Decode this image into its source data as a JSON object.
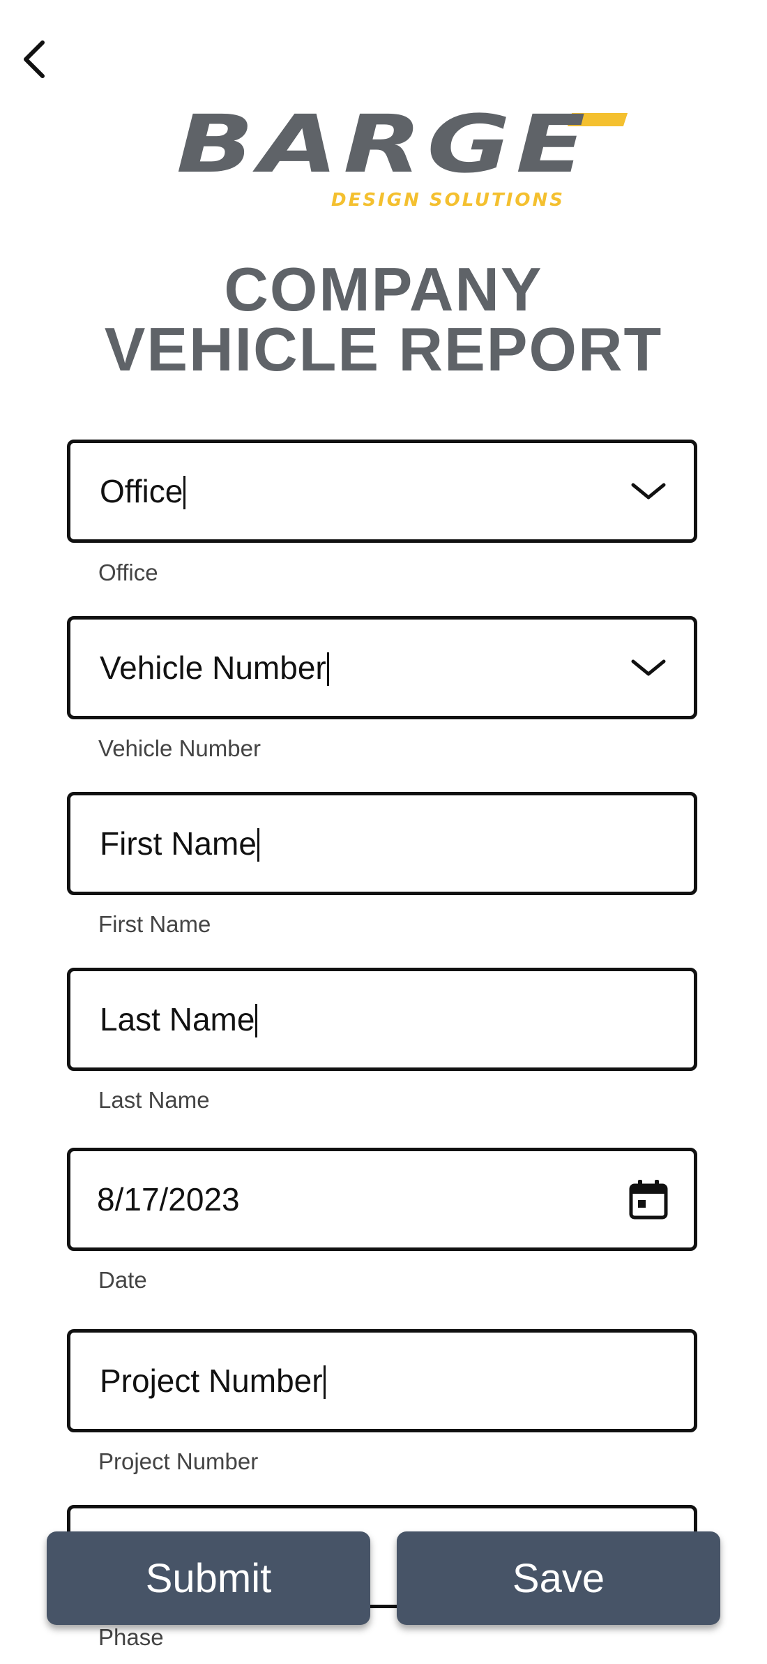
{
  "nav": {
    "back_icon": "chevron-left-icon"
  },
  "logo": {
    "word": "BARGE",
    "tagline": "DESIGN SOLUTIONS",
    "brand_gray": "#5f6368",
    "brand_yellow": "#f4c02f"
  },
  "title": {
    "line1": "COMPANY",
    "line2": "VEHICLE REPORT"
  },
  "form": {
    "office": {
      "value": "Office",
      "label": "Office",
      "icon": "chevron-down-icon"
    },
    "vehicle_number": {
      "value": "Vehicle Number",
      "label": "Vehicle Number",
      "icon": "chevron-down-icon"
    },
    "first_name": {
      "value": "First Name",
      "label": "First Name"
    },
    "last_name": {
      "value": "Last Name",
      "label": "Last Name"
    },
    "date": {
      "value": "8/17/2023",
      "label": "Date",
      "icon": "calendar-icon"
    },
    "project_number": {
      "value": "Project Number",
      "label": "Project Number"
    },
    "phase": {
      "value": "",
      "label": "Phase"
    }
  },
  "actions": {
    "submit_label": "Submit",
    "save_label": "Save",
    "button_color": "#475467"
  }
}
